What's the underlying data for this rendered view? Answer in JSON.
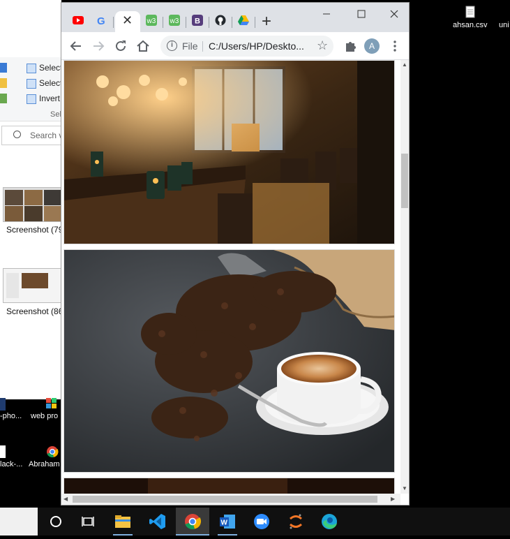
{
  "desktop": {
    "files": [
      {
        "label": "ahsan.csv"
      },
      {
        "label": "uni"
      },
      {
        "label": "-pho..."
      },
      {
        "label": "web pro"
      },
      {
        "label": "lack-..."
      },
      {
        "label": "Abraham"
      }
    ]
  },
  "explorer": {
    "ribbon": [
      "Select",
      "Select",
      "Invert"
    ],
    "ribbon_group": "Sel",
    "search_placeholder": "Search v",
    "thumbnails": [
      {
        "label": "Screenshot (79"
      },
      {
        "label": "Screenshot (86"
      }
    ]
  },
  "browser": {
    "tabs": [
      {
        "icon": "youtube-icon",
        "color": "#ff0000"
      },
      {
        "icon": "google-icon",
        "color": "#4285f4"
      },
      {
        "icon": "close-icon",
        "active": true
      },
      {
        "icon": "w3schools-icon",
        "color": "#5cb85c"
      },
      {
        "icon": "w3schools-icon",
        "color": "#5cb85c"
      },
      {
        "icon": "bootstrap-icon",
        "color": "#563d7c"
      },
      {
        "icon": "github-icon",
        "color": "#24292e"
      },
      {
        "icon": "google-drive-icon",
        "color": "#fbbc04"
      }
    ],
    "omnibox": {
      "scheme_label": "File",
      "url": "C:/Users/HP/Deskto..."
    },
    "profile_initial": "A",
    "page": {
      "images": [
        {
          "subject": "restaurant interior with glowing chandeliers"
        },
        {
          "subject": "cup of coffee with coffee beans and burlap sack"
        },
        {
          "subject": "dark restaurant photo"
        }
      ]
    }
  },
  "taskbar": {
    "apps": [
      "start-icon",
      "task-view-icon",
      "file-explorer-icon",
      "vscode-icon",
      "chrome-icon",
      "word-icon",
      "zoom-icon",
      "jupyter-icon",
      "edge-icon"
    ]
  }
}
